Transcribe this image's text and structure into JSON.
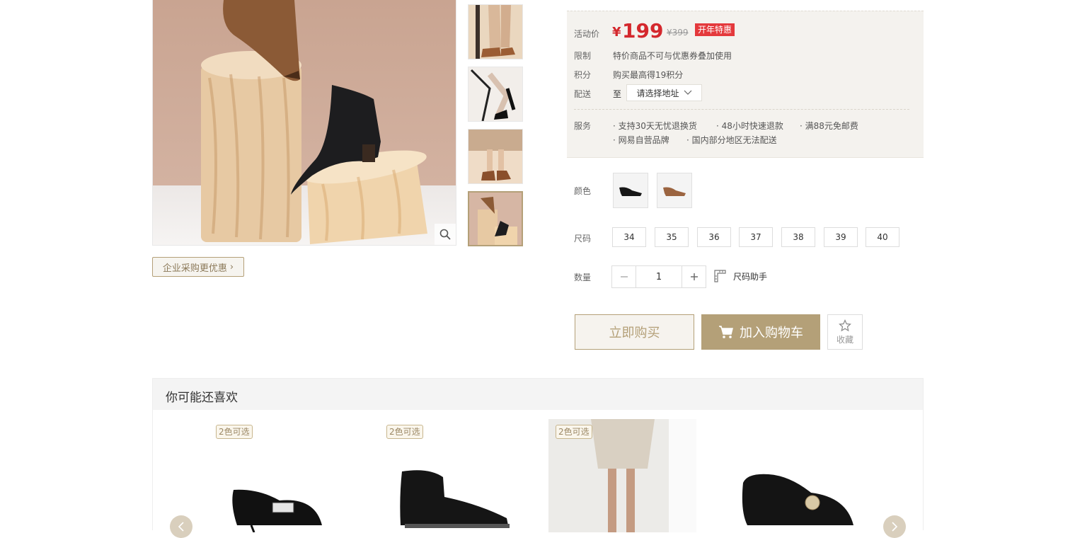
{
  "gallery": {
    "enterprise_link": "企业采购更优惠"
  },
  "price": {
    "label": "活动价",
    "currency": "¥",
    "current": "199",
    "original": "¥399",
    "promo_tag": "开年特惠"
  },
  "info_rows": [
    {
      "label": "限制",
      "value": "特价商品不可与优惠券叠加使用"
    },
    {
      "label": "积分",
      "value": "购买最高得19积分"
    },
    {
      "label": "配送",
      "value": "至"
    }
  ],
  "delivery": {
    "select_placeholder": "请选择地址"
  },
  "service": {
    "label": "服务",
    "items_line1": [
      "· 支持30天无忧退换货",
      "· 48小时快速退款",
      "· 满88元免邮费"
    ],
    "items_line2": [
      "· 网易自营品牌",
      "· 国内部分地区无法配送"
    ]
  },
  "options": {
    "color_label": "颜色",
    "colors": [
      "black",
      "brown"
    ],
    "size_label": "尺码",
    "sizes": [
      "34",
      "35",
      "36",
      "37",
      "38",
      "39",
      "40"
    ],
    "quantity_label": "数量",
    "quantity": "1",
    "size_helper": "尺码助手"
  },
  "actions": {
    "buy_now": "立即购买",
    "add_to_cart": "加入购物车",
    "favorite": "收藏"
  },
  "recommendations": {
    "title": "你可能还喜欢",
    "items": [
      {
        "badge": "2色可选"
      },
      {
        "badge": "2色可选"
      },
      {
        "badge": "2色可选"
      },
      {
        "badge": ""
      }
    ]
  },
  "colors": {
    "accent": "#b4a078",
    "price_red": "#d4282d",
    "panel_bg": "#f4f2ee"
  }
}
